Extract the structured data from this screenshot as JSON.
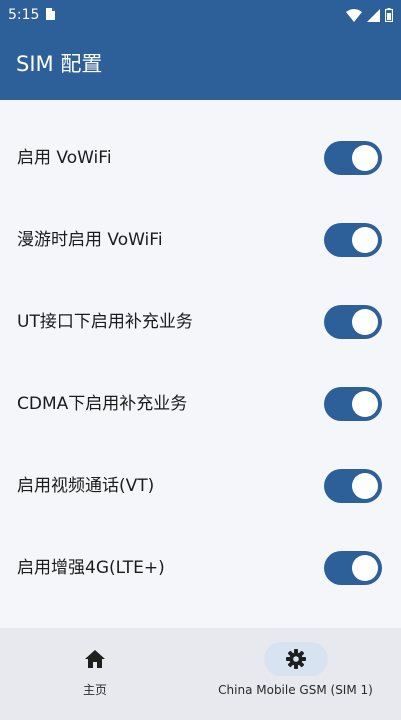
{
  "status_bar": {
    "time": "5:15",
    "icons": [
      "notification-icon",
      "wifi-icon",
      "signal-icon",
      "battery-icon"
    ]
  },
  "app_bar": {
    "title": "SIM 配置"
  },
  "settings": [
    {
      "label": "启用 VoWiFi",
      "enabled": true
    },
    {
      "label": "漫游时启用 VoWiFi",
      "enabled": true
    },
    {
      "label": "UT接口下启用补充业务",
      "enabled": true
    },
    {
      "label": "CDMA下启用补充业务",
      "enabled": true
    },
    {
      "label": "启用视频通话(VT)",
      "enabled": true
    },
    {
      "label": "启用增强4G(LTE+)",
      "enabled": true
    }
  ],
  "bottom_nav": {
    "items": [
      {
        "label": "主页",
        "icon": "home-icon",
        "selected": false
      },
      {
        "label": "China Mobile GSM (SIM 1)",
        "icon": "gear-icon",
        "selected": true
      }
    ]
  },
  "colors": {
    "primary": "#2d5f99",
    "background": "#f5f6fa",
    "nav_background": "#e8e9ee",
    "nav_selected_pill": "#d8e3f1"
  }
}
